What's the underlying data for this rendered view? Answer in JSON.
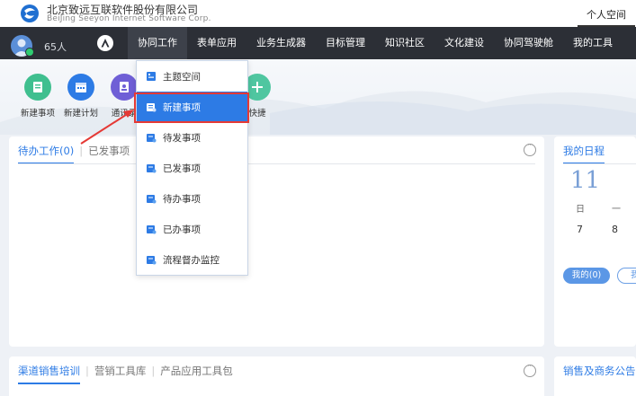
{
  "header": {
    "company_name": "北京致远互联软件股份有限公司",
    "company_name_en": "BeiJing Seeyon Internet Software Corp.",
    "personal_space": "个人空间"
  },
  "navbar": {
    "member_count": "65人",
    "items": [
      {
        "label": "协同工作",
        "active": true
      },
      {
        "label": "表单应用"
      },
      {
        "label": "业务生成器"
      },
      {
        "label": "目标管理"
      },
      {
        "label": "知识社区"
      },
      {
        "label": "文化建设"
      },
      {
        "label": "协同驾驶舱"
      },
      {
        "label": "我的工具"
      }
    ]
  },
  "quick_actions": [
    {
      "label": "新建事项",
      "icon": "new-item-icon",
      "color": "#3fbf8f"
    },
    {
      "label": "新建计划",
      "icon": "new-plan-icon",
      "color": "#2d7be5"
    },
    {
      "label": "通讯录",
      "icon": "contacts-icon",
      "color": "#6f5fd6"
    },
    {
      "label": "快捷",
      "icon": "add-shortcut-icon",
      "color": "#4fc6a0"
    }
  ],
  "dropdown": {
    "items": [
      {
        "label": "主题空间",
        "icon": "theme-space-icon"
      },
      {
        "label": "新建事项",
        "icon": "new-item-icon",
        "selected": true
      },
      {
        "label": "待发事项",
        "icon": "pending-send-icon"
      },
      {
        "label": "已发事项",
        "icon": "sent-item-icon"
      },
      {
        "label": "待办事项",
        "icon": "todo-item-icon"
      },
      {
        "label": "已办事项",
        "icon": "done-item-icon"
      },
      {
        "label": "流程督办监控",
        "icon": "process-monitor-icon"
      }
    ]
  },
  "todo_card": {
    "tab_active": "待办工作(0)",
    "tab_sent": "已发事项"
  },
  "schedule_card": {
    "title": "我的日程",
    "date": "11",
    "weekday_1": "日",
    "weekday_2": "一",
    "day_1": "7",
    "day_2": "8",
    "mine_button": "我的(0)",
    "other_button": "我"
  },
  "bottom_card": {
    "tabs": [
      "渠道销售培训",
      "营销工具库",
      "产品应用工具包"
    ]
  },
  "bottom_right_card": {
    "title": "销售及商务公告"
  },
  "colors": {
    "accent": "#2d7be5",
    "navbar_bg": "#2c2f36",
    "highlight_border": "#e53935"
  }
}
